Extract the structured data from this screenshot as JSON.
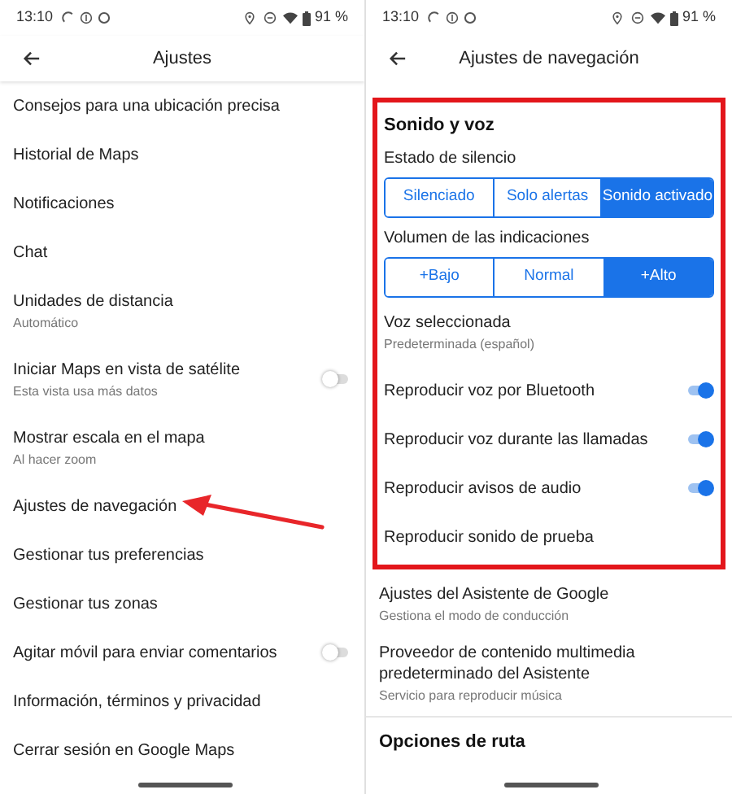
{
  "screens": [
    {
      "status_bar": {
        "time": "13:10",
        "battery": "91 %"
      },
      "header": {
        "title": "Ajustes"
      },
      "rows": [
        {
          "kind": "item",
          "label": "Consejos para una ubicación precisa"
        },
        {
          "kind": "item",
          "label": "Historial de Maps"
        },
        {
          "kind": "item",
          "label": "Notificaciones"
        },
        {
          "kind": "item",
          "label": "Chat"
        },
        {
          "kind": "item",
          "label": "Unidades de distancia",
          "sub": "Automático"
        },
        {
          "kind": "toggle",
          "label": "Iniciar Maps en vista de satélite",
          "sub": "Esta vista usa más datos",
          "on": false
        },
        {
          "kind": "item",
          "label": "Mostrar escala en el mapa",
          "sub": "Al hacer zoom"
        },
        {
          "kind": "item",
          "label": "Ajustes de navegación",
          "pointed": true
        },
        {
          "kind": "item",
          "label": "Gestionar tus preferencias"
        },
        {
          "kind": "item",
          "label": "Gestionar tus zonas"
        },
        {
          "kind": "toggle",
          "label": "Agitar móvil para enviar comentarios",
          "on": false
        },
        {
          "kind": "item",
          "label": "Información, términos y privacidad"
        },
        {
          "kind": "item",
          "label": "Cerrar sesión en Google Maps"
        }
      ]
    },
    {
      "status_bar": {
        "time": "13:10",
        "battery": "91 %"
      },
      "header": {
        "title": "Ajustes de navegación"
      },
      "highlight_rows": [
        {
          "kind": "heading",
          "label": "Sonido y voz"
        },
        {
          "kind": "label",
          "label": "Estado de silencio"
        },
        {
          "kind": "segmented",
          "options": [
            {
              "label": "Silenciado",
              "selected": false
            },
            {
              "label": "Solo alertas",
              "selected": false
            },
            {
              "label": "Sonido activado",
              "selected": true
            }
          ]
        },
        {
          "kind": "label",
          "label": "Volumen de las indicaciones"
        },
        {
          "kind": "segmented",
          "options": [
            {
              "label": "+Bajo",
              "selected": false
            },
            {
              "label": "Normal",
              "selected": false
            },
            {
              "label": "+Alto",
              "selected": true
            }
          ]
        },
        {
          "kind": "item",
          "label": "Voz seleccionada",
          "sub": "Predeterminada (español)"
        },
        {
          "kind": "toggle",
          "label": "Reproducir voz por Bluetooth",
          "on": true
        },
        {
          "kind": "toggle",
          "label": "Reproducir voz durante las llamadas",
          "on": true
        },
        {
          "kind": "toggle",
          "label": "Reproducir avisos de audio",
          "on": true
        },
        {
          "kind": "item",
          "label": "Reproducir sonido de prueba"
        }
      ],
      "rows": [
        {
          "kind": "item",
          "label": "Ajustes del Asistente de Google",
          "sub": "Gestiona el modo de conducción"
        },
        {
          "kind": "item",
          "label": "Proveedor de contenido multimedia predeterminado del Asistente",
          "sub": "Servicio para reproducir música"
        },
        {
          "kind": "section",
          "label": "Opciones de ruta"
        }
      ]
    }
  ]
}
